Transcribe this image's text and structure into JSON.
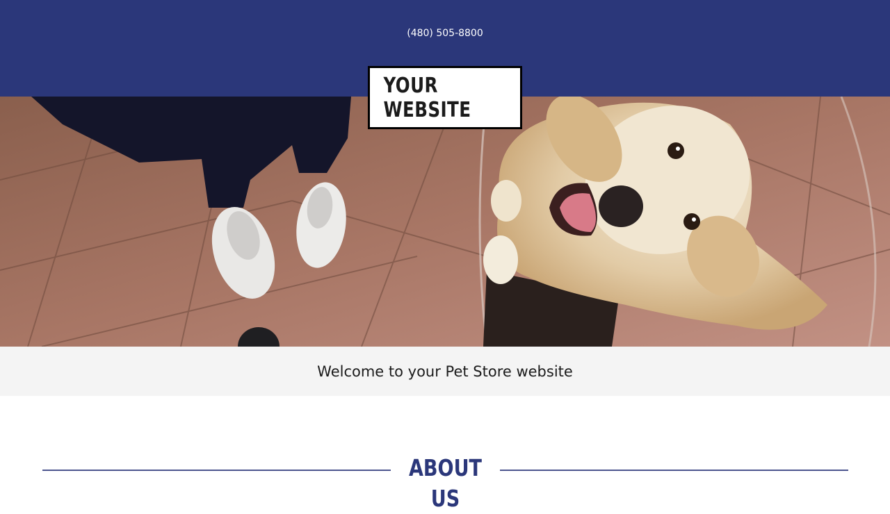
{
  "header": {
    "phone": "(480) 505-8800",
    "logo_text": "YOUR WEBSITE",
    "background_color": "#2b377a"
  },
  "hero": {
    "image_subject": "golden retriever looking up beside person in white sneakers on tiled floor"
  },
  "welcome": {
    "text": "Welcome to your Pet Store website"
  },
  "about": {
    "heading": "ABOUT US"
  }
}
